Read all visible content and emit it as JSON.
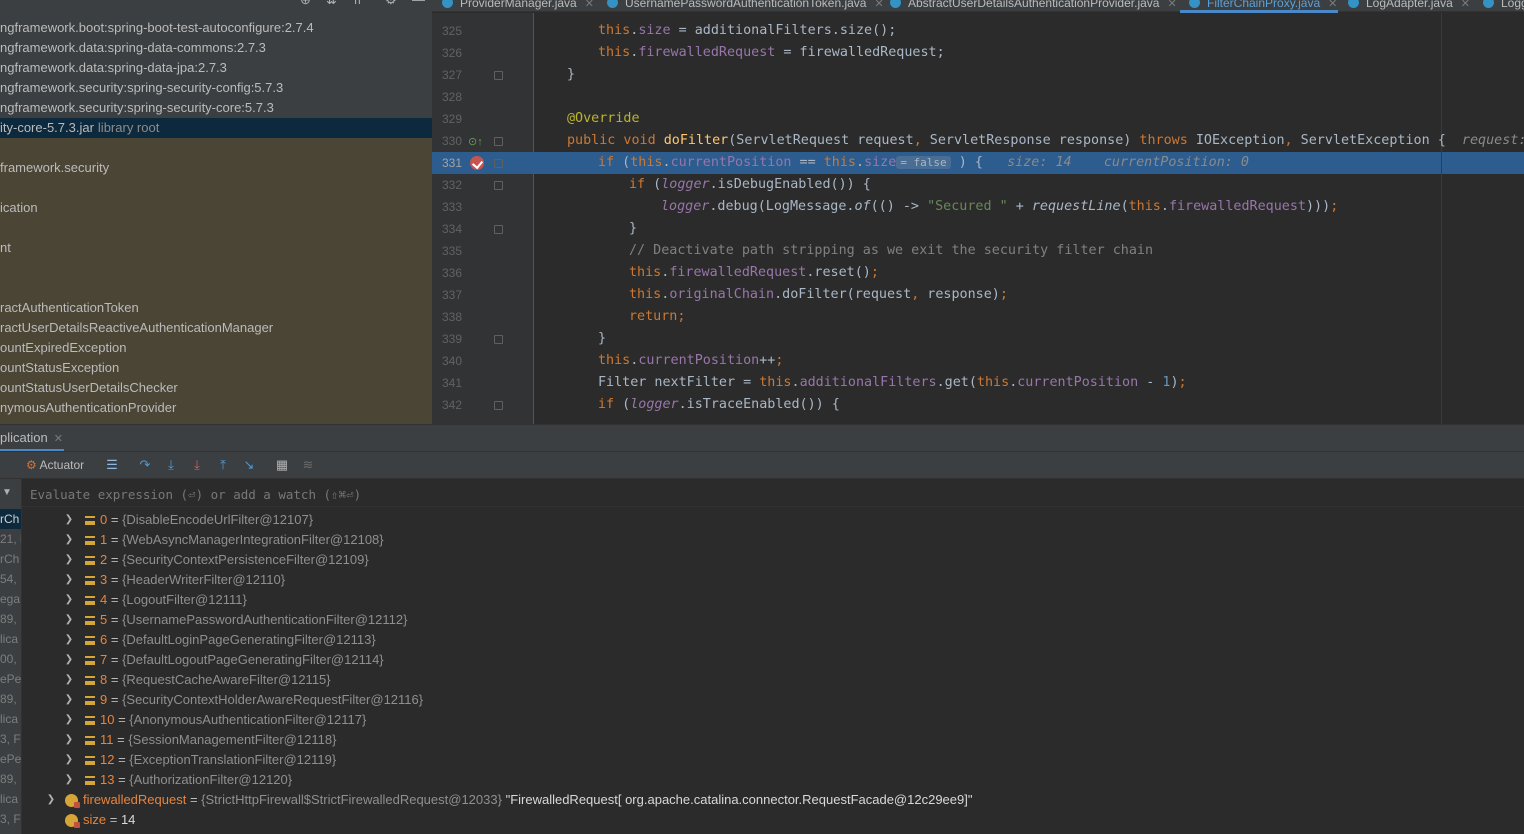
{
  "project_tree": {
    "rows": [
      {
        "label": "ngframework.boot:spring-boot-test-autoconfigure:2.7.4",
        "suffix": ""
      },
      {
        "label": "ngframework.data:spring-data-commons:2.7.3",
        "suffix": ""
      },
      {
        "label": "ngframework.data:spring-data-jpa:2.7.3",
        "suffix": ""
      },
      {
        "label": "ngframework.security:spring-security-config:5.7.3",
        "suffix": ""
      },
      {
        "label": "ngframework.security:spring-security-core:5.7.3",
        "suffix": ""
      },
      {
        "label": "ity-core-5.7.3.jar",
        "suffix": "library root"
      },
      {
        "label": "",
        "suffix": ""
      },
      {
        "label": "framework.security",
        "suffix": ""
      },
      {
        "label": "",
        "suffix": ""
      },
      {
        "label": "ication",
        "suffix": ""
      },
      {
        "label": "",
        "suffix": ""
      },
      {
        "label": "nt",
        "suffix": ""
      },
      {
        "label": "",
        "suffix": ""
      },
      {
        "label": "",
        "suffix": ""
      },
      {
        "label": "ractAuthenticationToken",
        "suffix": ""
      },
      {
        "label": "ractUserDetailsReactiveAuthenticationManager",
        "suffix": ""
      },
      {
        "label": "ountExpiredException",
        "suffix": ""
      },
      {
        "label": "ountStatusException",
        "suffix": ""
      },
      {
        "label": "ountStatusUserDetailsChecker",
        "suffix": ""
      },
      {
        "label": "nymousAuthenticationProvider",
        "suffix": ""
      }
    ]
  },
  "editor": {
    "tabs": [
      {
        "label": "ProviderManager.java",
        "active": false
      },
      {
        "label": "UsernamePasswordAuthenticationToken.java",
        "active": false
      },
      {
        "label": "AbstractUserDetailsAuthenticationProvider.java",
        "active": false
      },
      {
        "label": "FilterChainProxy.java",
        "active": true
      },
      {
        "label": "LogAdapter.java",
        "active": false
      },
      {
        "label": "Logg",
        "active": false
      }
    ],
    "line_numbers": [
      "325",
      "326",
      "327",
      "328",
      "329",
      "330",
      "331",
      "332",
      "333",
      "334",
      "335",
      "336",
      "337",
      "338",
      "339",
      "340",
      "341",
      "342"
    ],
    "current_line": "331",
    "hints": {
      "line330": "request: \"F",
      "cond_value": "= false",
      "size": "size: 14",
      "position": "currentPosition: 0"
    }
  },
  "debug": {
    "tab_label": "plication",
    "toolbar": {
      "actuator_label": "Actuator"
    },
    "eval_placeholder": "Evaluate expression (⏎) or add a watch (⇧⌘⏎)",
    "frames": [
      "rCh",
      "21, l",
      "rCh",
      "54,",
      "ega",
      "89,",
      "lica",
      "00,",
      "ePe",
      "89,",
      "lica",
      "3, F",
      "ePe",
      "89,",
      "lica",
      "3, F"
    ],
    "variables": [
      {
        "name": "0",
        "type": "{DisableEncodeUrlFilter@12107}"
      },
      {
        "name": "1",
        "type": "{WebAsyncManagerIntegrationFilter@12108}"
      },
      {
        "name": "2",
        "type": "{SecurityContextPersistenceFilter@12109}"
      },
      {
        "name": "3",
        "type": "{HeaderWriterFilter@12110}"
      },
      {
        "name": "4",
        "type": "{LogoutFilter@12111}"
      },
      {
        "name": "5",
        "type": "{UsernamePasswordAuthenticationFilter@12112}"
      },
      {
        "name": "6",
        "type": "{DefaultLoginPageGeneratingFilter@12113}"
      },
      {
        "name": "7",
        "type": "{DefaultLogoutPageGeneratingFilter@12114}"
      },
      {
        "name": "8",
        "type": "{RequestCacheAwareFilter@12115}"
      },
      {
        "name": "9",
        "type": "{SecurityContextHolderAwareRequestFilter@12116}"
      },
      {
        "name": "10",
        "type": "{AnonymousAuthenticationFilter@12117}"
      },
      {
        "name": "11",
        "type": "{SessionManagementFilter@12118}"
      },
      {
        "name": "12",
        "type": "{ExceptionTranslationFilter@12119}"
      },
      {
        "name": "13",
        "type": "{AuthorizationFilter@12120}"
      }
    ],
    "fields": [
      {
        "name": "firewalledRequest",
        "type": "{StrictHttpFirewall$StrictFirewalledRequest@12033}",
        "value": "\"FirewalledRequest[ org.apache.catalina.connector.RequestFacade@12c29ee9]\""
      },
      {
        "name": "size",
        "type": "",
        "value": "14"
      }
    ]
  },
  "colors": {
    "selection": "#2d5c8f",
    "accent": "#4a88c7",
    "keyword": "#cc7832",
    "field": "#9876aa"
  }
}
